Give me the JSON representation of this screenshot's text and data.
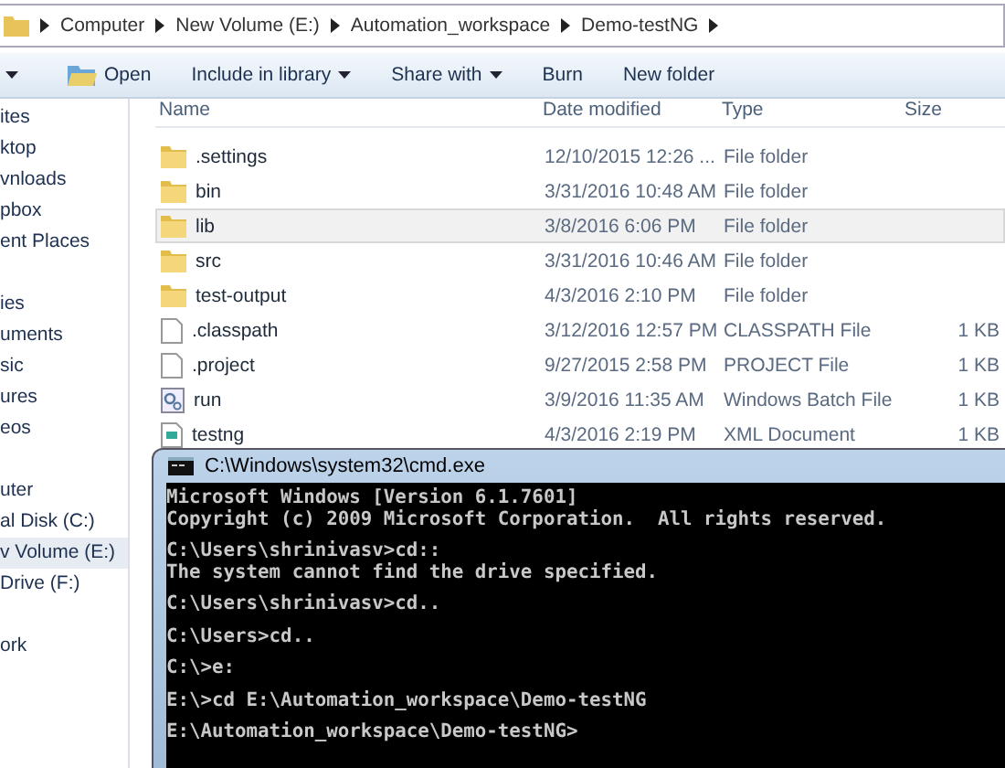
{
  "address_bar": {
    "crumbs": [
      "Computer",
      "New Volume (E:)",
      "Automation_workspace",
      "Demo-testNG"
    ]
  },
  "toolbar": {
    "buttons": [
      {
        "label": "Open",
        "kind": "open"
      },
      {
        "label": "Include in library",
        "kind": "menu"
      },
      {
        "label": "Share with",
        "kind": "menu"
      },
      {
        "label": "Burn",
        "kind": "plain"
      },
      {
        "label": "New folder",
        "kind": "plain"
      }
    ]
  },
  "sidebar": {
    "groups": [
      {
        "items": [
          {
            "label": "ites",
            "selected": false
          },
          {
            "label": "ktop",
            "selected": false
          },
          {
            "label": "vnloads",
            "selected": false
          },
          {
            "label": "pbox",
            "selected": false
          },
          {
            "label": "ent Places",
            "selected": false
          }
        ]
      },
      {
        "items": [
          {
            "label": "ies",
            "selected": false
          },
          {
            "label": "uments",
            "selected": false
          },
          {
            "label": "sic",
            "selected": false
          },
          {
            "label": "ures",
            "selected": false
          },
          {
            "label": "eos",
            "selected": false
          }
        ]
      },
      {
        "items": [
          {
            "label": "uter",
            "selected": false
          },
          {
            "label": "al Disk (C:)",
            "selected": false
          },
          {
            "label": "v Volume (E:)",
            "selected": true
          },
          {
            "label": "Drive (F:)",
            "selected": false
          }
        ]
      },
      {
        "items": [
          {
            "label": "ork",
            "selected": false
          }
        ]
      }
    ]
  },
  "table": {
    "columns": [
      "Name",
      "Date modified",
      "Type",
      "Size"
    ],
    "rows": [
      {
        "kind": "folder",
        "name": ".settings",
        "date": "12/10/2015 12:26 ...",
        "type": "File folder",
        "size": null,
        "selected": false
      },
      {
        "kind": "folder",
        "name": "bin",
        "date": "3/31/2016 10:48 AM",
        "type": "File folder",
        "size": null,
        "selected": false
      },
      {
        "kind": "folder",
        "name": "lib",
        "date": "3/8/2016 6:06 PM",
        "type": "File folder",
        "size": null,
        "selected": true
      },
      {
        "kind": "folder",
        "name": "src",
        "date": "3/31/2016 10:46 AM",
        "type": "File folder",
        "size": null,
        "selected": false
      },
      {
        "kind": "folder",
        "name": "test-output",
        "date": "4/3/2016 2:10 PM",
        "type": "File folder",
        "size": null,
        "selected": false
      },
      {
        "kind": "file",
        "name": ".classpath",
        "date": "3/12/2016 12:57 PM",
        "type": "CLASSPATH File",
        "size": "1 KB",
        "selected": false
      },
      {
        "kind": "file",
        "name": ".project",
        "date": "9/27/2015 2:58 PM",
        "type": "PROJECT File",
        "size": "1 KB",
        "selected": false
      },
      {
        "kind": "batch",
        "name": "run",
        "date": "3/9/2016 11:35 AM",
        "type": "Windows Batch File",
        "size": "1 KB",
        "selected": false
      },
      {
        "kind": "xml",
        "name": "testng",
        "date": "4/3/2016 2:19 PM",
        "type": "XML Document",
        "size": "1 KB",
        "selected": false
      }
    ]
  },
  "console": {
    "title": "C:\\Windows\\system32\\cmd.exe",
    "blocks": [
      [
        "Microsoft Windows [Version 6.1.7601]",
        "Copyright (c) 2009 Microsoft Corporation.  All rights reserved."
      ],
      [
        "C:\\Users\\shrinivasv>cd::",
        "The system cannot find the drive specified."
      ],
      [
        "C:\\Users\\shrinivasv>cd.."
      ],
      [
        "C:\\Users>cd.."
      ],
      [
        "C:\\>e:"
      ],
      [
        "E:\\>cd E:\\Automation_workspace\\Demo-testNG"
      ],
      [
        "E:\\Automation_workspace\\Demo-testNG>"
      ]
    ]
  }
}
